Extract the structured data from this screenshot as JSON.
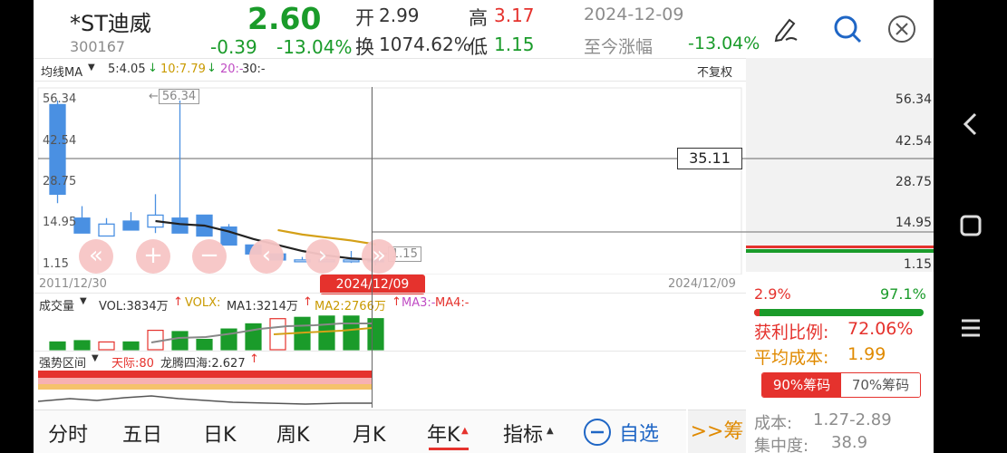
{
  "header": {
    "stock_name": "*ST迪威",
    "stock_code": "300167",
    "price": "2.60",
    "change": "-0.39",
    "change_pct": "-13.04%",
    "open_label": "开",
    "open_value": "2.99",
    "high_label": "高",
    "high_value": "3.17",
    "turnover_label": "换",
    "turnover_value": "1074.62%",
    "low_label": "低",
    "low_value": "1.15",
    "date": "2024-12-09",
    "since_label": "至今涨幅",
    "since_value": "-13.04%"
  },
  "ma_bar": {
    "label": "均线MA",
    "ma5": "5:4.05",
    "ma10": "10:7.79",
    "ma20": "20:-",
    "ma30": "30:-",
    "adjust": "不复权"
  },
  "price_axis": [
    "56.34",
    "42.54",
    "28.75",
    "14.95",
    "1.15"
  ],
  "crosshair_price": "35.11",
  "max_marker": "56.34",
  "min_marker": "1.15",
  "date_start": "2011/12/30",
  "date_end": "2024/12/09",
  "crosshair_date": "2024/12/09",
  "volume_bar": {
    "label": "成交量",
    "vol": "VOL:3834万",
    "volx": "VOLX:",
    "ma1": "MA1:3214万",
    "ma2": "MA2:2766万",
    "ma3": "MA3:-",
    "ma4": "MA4:-"
  },
  "strength_bar": {
    "label": "强势区间",
    "tianji": "天际:80",
    "longteng": "龙腾四海:2.627"
  },
  "chips": {
    "loss_pct": "2.9%",
    "profit_pct": "97.1%",
    "profit_ratio_label": "获利比例:",
    "profit_ratio": "72.06%",
    "avg_cost_label": "平均成本:",
    "avg_cost": "1.99",
    "tab90": "90%筹码",
    "tab70": "70%筹码",
    "cost_label": "成本:",
    "cost_range": "1.27-2.89",
    "concentration_label": "集中度:",
    "concentration": "38.9"
  },
  "bottom_tabs": [
    "分时",
    "五日",
    "日K",
    "周K",
    "月K",
    "年K",
    "指标"
  ],
  "add_watch": "自选",
  "chips_tab": ">>筹",
  "colors": {
    "up": "#e5322d",
    "down": "#4a90e2",
    "green": "#1a9b2a",
    "accent": "#1f66c5"
  },
  "chart_data": {
    "type": "candlestick",
    "candles": [
      {
        "open": 55,
        "high": 56.34,
        "low": 22,
        "close": 25
      },
      {
        "open": 17,
        "high": 21,
        "low": 12,
        "close": 12
      },
      {
        "open": 11,
        "high": 17,
        "low": 11,
        "close": 15
      },
      {
        "open": 16,
        "high": 19,
        "low": 13,
        "close": 13
      },
      {
        "open": 14,
        "high": 25,
        "low": 12,
        "close": 18
      },
      {
        "open": 17,
        "high": 56.34,
        "low": 12,
        "close": 12
      },
      {
        "open": 18,
        "high": 18,
        "low": 11,
        "close": 11
      },
      {
        "open": 14,
        "high": 15,
        "low": 8,
        "close": 8
      },
      {
        "open": 8,
        "high": 8,
        "low": 5,
        "close": 5
      },
      {
        "open": 5,
        "high": 5,
        "low": 3,
        "close": 3
      },
      {
        "open": 3,
        "high": 4,
        "low": 3,
        "close": 3
      },
      {
        "open": 3,
        "high": 3.5,
        "low": 2.5,
        "close": 3
      },
      {
        "open": 3,
        "high": 6,
        "low": 2,
        "close": 3
      },
      {
        "open": 2.99,
        "high": 3.17,
        "low": 1.15,
        "close": 2.6
      }
    ],
    "ma5": [
      null,
      null,
      null,
      null,
      16,
      15,
      14.5,
      12.5,
      10,
      8,
      6,
      4.5,
      3.5,
      3
    ],
    "ma10": [
      null,
      null,
      null,
      null,
      null,
      null,
      null,
      null,
      null,
      13,
      11.5,
      10.5,
      9.5,
      8.2
    ],
    "ylim": [
      1.15,
      56.34
    ],
    "volume": [
      {
        "v": 0.3,
        "up": false
      },
      {
        "v": 0.35,
        "up": false
      },
      {
        "v": 0.3,
        "up": true
      },
      {
        "v": 0.3,
        "up": false
      },
      {
        "v": 0.75,
        "up": true
      },
      {
        "v": 0.7,
        "up": false
      },
      {
        "v": 0.4,
        "up": false
      },
      {
        "v": 0.8,
        "up": false
      },
      {
        "v": 1.0,
        "up": false
      },
      {
        "v": 1.2,
        "up": true
      },
      {
        "v": 1.25,
        "up": false
      },
      {
        "v": 1.3,
        "up": false
      },
      {
        "v": 1.3,
        "up": false
      },
      {
        "v": 1.2,
        "up": false
      }
    ]
  }
}
